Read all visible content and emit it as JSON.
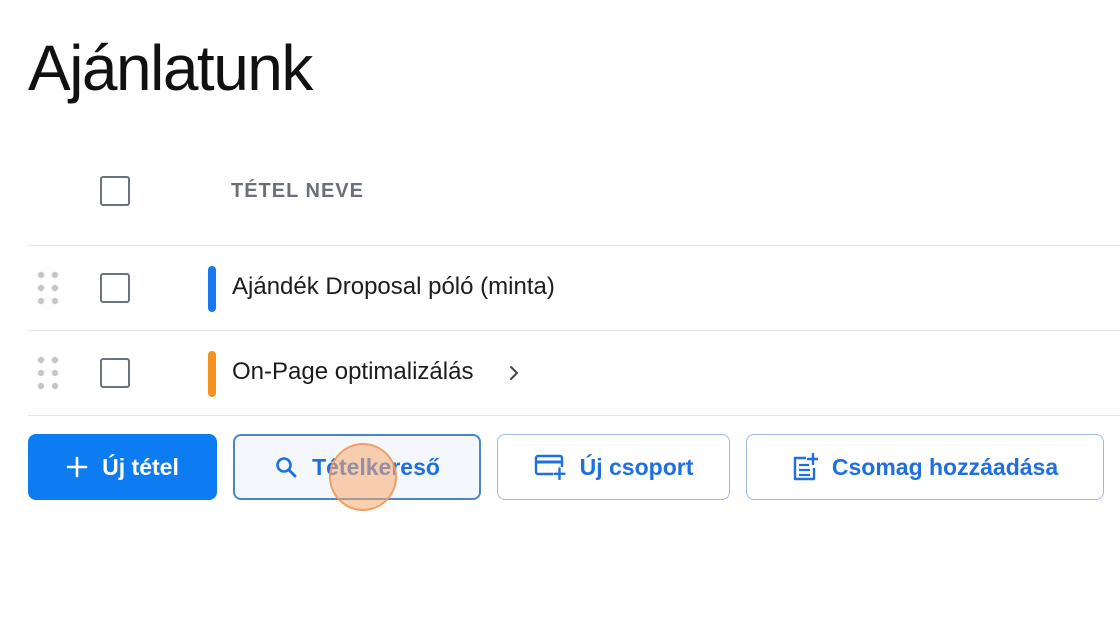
{
  "page": {
    "title": "Ajánlatunk"
  },
  "table": {
    "column_header": "TÉTEL NEVE",
    "rows": [
      {
        "name": "Ajándék Droposal póló (minta)",
        "color": "#1877f2",
        "has_children": false
      },
      {
        "name": "On-Page optimalizálás",
        "color": "#f5921e",
        "has_children": true
      }
    ]
  },
  "actions": {
    "new_item": {
      "label": "Új tétel",
      "icon": "plus-icon"
    },
    "item_search": {
      "label": "Tételkereső",
      "icon": "search-icon"
    },
    "new_group": {
      "label": "Új csoport",
      "icon": "add-card-icon"
    },
    "add_package": {
      "label": "Csomag hozzáadása",
      "icon": "add-list-icon"
    }
  },
  "colors": {
    "primary": "#0d7cf2",
    "outline_text": "#1f6fe0",
    "header_text": "#6b7078"
  }
}
